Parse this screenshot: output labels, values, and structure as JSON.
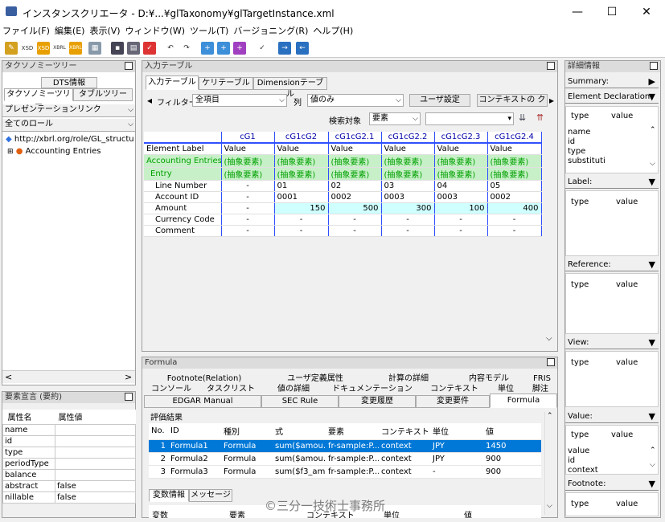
{
  "window": {
    "title": "インスタンスクリエータ - D:¥...¥glTaxonomy¥glTargetInstance.xml",
    "minimize": "—",
    "maximize": "☐",
    "close": "✕"
  },
  "menu": [
    "ファイル(F)",
    "編集(E)",
    "表示(V)",
    "ウィンドウ(W)",
    "ツール(T)",
    "バージョニング(R)",
    "ヘルプ(H)"
  ],
  "toolbar_icons": [
    "open-icon",
    "xsd-icon",
    "xsd-new-icon",
    "xbrl-icon",
    "xbrl-new-icon",
    "grid-icon",
    "save-icon",
    "layout-icon",
    "check-icon",
    "undo-icon",
    "redo-icon",
    "insert-icon",
    "add-icon",
    "add2-icon",
    "validate-icon",
    "import-icon",
    "export-icon"
  ],
  "toolbar_labels": {
    "xsd": "XSD",
    "xsd_new": "XSD",
    "xbrl": "XBRL",
    "xbrl_new": "XBRL"
  },
  "taxonomy_panel": {
    "title": "タクソノミーツリー",
    "tabs": {
      "dts": "DTS情報",
      "tree": "タクソノミーツリー",
      "table": "タブルツリー"
    },
    "presentation": "プレゼンテーションリンク",
    "role_filter": "全てのロール",
    "tree": [
      {
        "label": "http://xbrl.org/role/GL_structure"
      },
      {
        "label": "Accounting Entries"
      }
    ]
  },
  "element_decl_panel": {
    "title": "要素宣言 (要約)",
    "col_name": "属性名",
    "col_value": "属性値",
    "rows": [
      {
        "name": "name",
        "value": ""
      },
      {
        "name": "id",
        "value": ""
      },
      {
        "name": "type",
        "value": ""
      },
      {
        "name": "periodType",
        "value": ""
      },
      {
        "name": "balance",
        "value": ""
      },
      {
        "name": "abstract",
        "value": "false"
      },
      {
        "name": "nillable",
        "value": "false"
      }
    ]
  },
  "input_panel": {
    "title": "入力テーブル",
    "tabs": [
      "入力テーブル",
      "ケリテーブル",
      "Dimensionテーブル"
    ],
    "filter_label": "フィルター",
    "filter_value": "全項目",
    "column_label": "列",
    "column_value": "値のみ",
    "user_setting": "ユーザ設定",
    "context_button": "コンテキストの ク",
    "search_label": "検索対象",
    "search_target": "要素",
    "search_value": "",
    "grid": {
      "col_headers": [
        "cG1",
        "cG1cG2",
        "cG1cG2.1",
        "cG1cG2.2",
        "cG1cG2.3",
        "cG1cG2.4"
      ],
      "label_header": "Element Label",
      "value_header": "Value",
      "rows": [
        {
          "label": "Accounting Entries",
          "values": [
            "(抽象要素)",
            "(抽象要素)",
            "(抽象要素)",
            "(抽象要素)",
            "(抽象要素)",
            "(抽象要素)"
          ]
        },
        {
          "label": "Entry",
          "values": [
            "(抽象要素)",
            "(抽象要素)",
            "(抽象要素)",
            "(抽象要素)",
            "(抽象要素)",
            "(抽象要素)"
          ]
        },
        {
          "label": "Line Number",
          "values": [
            "-",
            "01",
            "02",
            "03",
            "04",
            "05"
          ]
        },
        {
          "label": "Account ID",
          "values": [
            "-",
            "0001",
            "0002",
            "0003",
            "0003",
            "0002"
          ]
        },
        {
          "label": "Amount",
          "values": [
            "-",
            "150",
            "500",
            "300",
            "100",
            "400"
          ]
        },
        {
          "label": "Currency Code",
          "values": [
            "-",
            "-",
            "-",
            "-",
            "-",
            "-"
          ]
        },
        {
          "label": "Comment",
          "values": [
            "-",
            "-",
            "-",
            "-",
            "-",
            "-"
          ]
        }
      ]
    }
  },
  "formula_panel": {
    "title": "Formula",
    "tabs_row1": [
      "Footnote(Relation)",
      "ユーザ定義属性",
      "計算の詳細",
      "内容モデル",
      "FRIS"
    ],
    "tabs_row2": [
      "コンソール",
      "タスクリスト",
      "値の詳細",
      "ドキュメンテーション",
      "コンテキスト",
      "単位",
      "脚注"
    ],
    "tabs_row3": [
      "EDGAR Manual",
      "SEC Rule",
      "変更履歴",
      "変更要件",
      "Formula"
    ],
    "eval_title": "評価結果",
    "eval_headers": [
      "No.",
      "ID",
      "種別",
      "式",
      "要素",
      "コンテキスト",
      "単位",
      "値"
    ],
    "eval_rows": [
      {
        "no": "1",
        "id": "Formula1",
        "kind": "Formula",
        "expr": "sum($amou...",
        "elem": "fr-sample:P...",
        "ctx": "context",
        "unit": "JPY",
        "value": "1450"
      },
      {
        "no": "2",
        "id": "Formula2",
        "kind": "Formula",
        "expr": "sum($amou...",
        "elem": "fr-sample:P...",
        "ctx": "context",
        "unit": "JPY",
        "value": "900"
      },
      {
        "no": "3",
        "id": "Formula3",
        "kind": "Formula",
        "expr": "sum($f3_am...",
        "elem": "fr-sample:P...",
        "ctx": "context",
        "unit": "-",
        "value": "900"
      }
    ],
    "var_tabs": [
      "変数情報",
      "メッセージ"
    ],
    "var_headers": [
      "変数",
      "要素",
      "コンテキスト",
      "単位",
      "値"
    ],
    "watermark": "©三分一技術士事務所"
  },
  "detail_panel": {
    "title": "詳細情報",
    "summary": "Summary:",
    "element_decl": "Element Declaration:",
    "type_label": "type",
    "value_label": "value",
    "decl_rows": [
      "name",
      "id",
      "type",
      "substituti"
    ],
    "label": "Label:",
    "reference": "Reference:",
    "view": "View:",
    "value_section": "Value:",
    "value_rows": [
      "value",
      "id",
      "context"
    ],
    "footnote": "Footnote:"
  }
}
